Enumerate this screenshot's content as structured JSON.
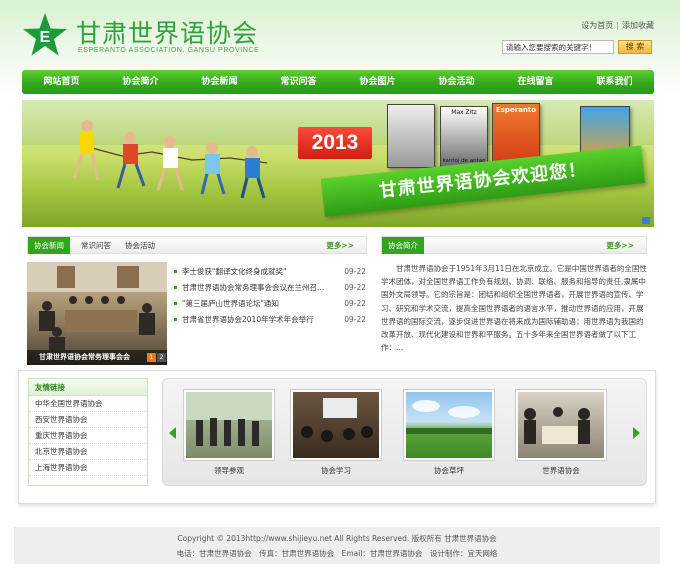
{
  "header": {
    "site_name": "甘肃世界语协会",
    "site_name_en": "ESPERANTO ASSOCIATION, GANSU PROVINCE",
    "logo_letter": "E",
    "set_homepage": "设为首页",
    "separator": "|",
    "add_favorite": "添加收藏",
    "search_placeholder": "请输入您要搜索的关键字！",
    "search_button": "搜 索"
  },
  "nav": [
    "网站首页",
    "协会简介",
    "协会新闻",
    "常识问答",
    "协会图片",
    "协会活动",
    "在线留言",
    "联系我们"
  ],
  "banner": {
    "year": "2013",
    "welcome": "甘肃世界语协会欢迎您！",
    "magazine_titles": [
      "Max Zitz",
      "Esperanto"
    ],
    "magazine_caption": "kantoj de antao"
  },
  "news_section": {
    "tabs": [
      "协会新闻",
      "常识问答",
      "协会活动"
    ],
    "more": "更多>>",
    "photo_caption": "甘肃世界语协会常务理事会会",
    "pager": [
      "1",
      "2"
    ],
    "items": [
      {
        "title": "李士俊获\"翻译文化终身成就奖\"",
        "date": "09-22"
      },
      {
        "title": "甘肃世界语协会常务理事会会议在兰州召...",
        "date": "09-22"
      },
      {
        "title": "\"第三届庐山世界语论坛\"通知",
        "date": "09-22"
      },
      {
        "title": "甘肃省世界语协会2010年学术年会举行",
        "date": "09-22"
      }
    ]
  },
  "intro_section": {
    "tab": "协会简介",
    "more": "更多>>",
    "text": "甘肃世界语协会于1951年3月11日在北京成立。它是中国世界语者的全国性学术团体，对全国世界语工作负有规划、协调、联络、服务和指导的责任,隶属中国外文局领导。它的宗旨是：团结和组织全国世界语者，开展世界语的宣传、学习、研究和学术交流，提高全国世界语者的语言水平，推动世界语的应用，开展世界语的国际交流，逐步促进世界语在将来成为国际辅助语；用世界语为我国的改革开放、现代化建设和世界和平服务。五十多年来全国世界语者做了以下工作：..."
  },
  "links": {
    "title": "友情链接",
    "items": [
      "中华全国世界语协会",
      "西安世界语协会",
      "重庆世界语协会",
      "北京世界语协会",
      "上海世界语协会"
    ]
  },
  "gallery": {
    "items": [
      {
        "label": "领导参观"
      },
      {
        "label": "协会学习"
      },
      {
        "label": "协会草坪"
      },
      {
        "label": "世界语协会"
      }
    ]
  },
  "footer": {
    "copyright": "Copyright © 2013http://www.shijieyu.net All Rights Reserved. 版权所有 甘肃世界语协会",
    "contact": "电话：甘肃世界语协会　传真：甘肃世界语协会　Email：甘肃世界语协会　设计制作：宜天网络"
  },
  "colors": {
    "brand_green": "#32a51d",
    "nav_green": "#34a81b",
    "accent_red": "#cc1f14",
    "search_orange": "#f0b93a"
  }
}
